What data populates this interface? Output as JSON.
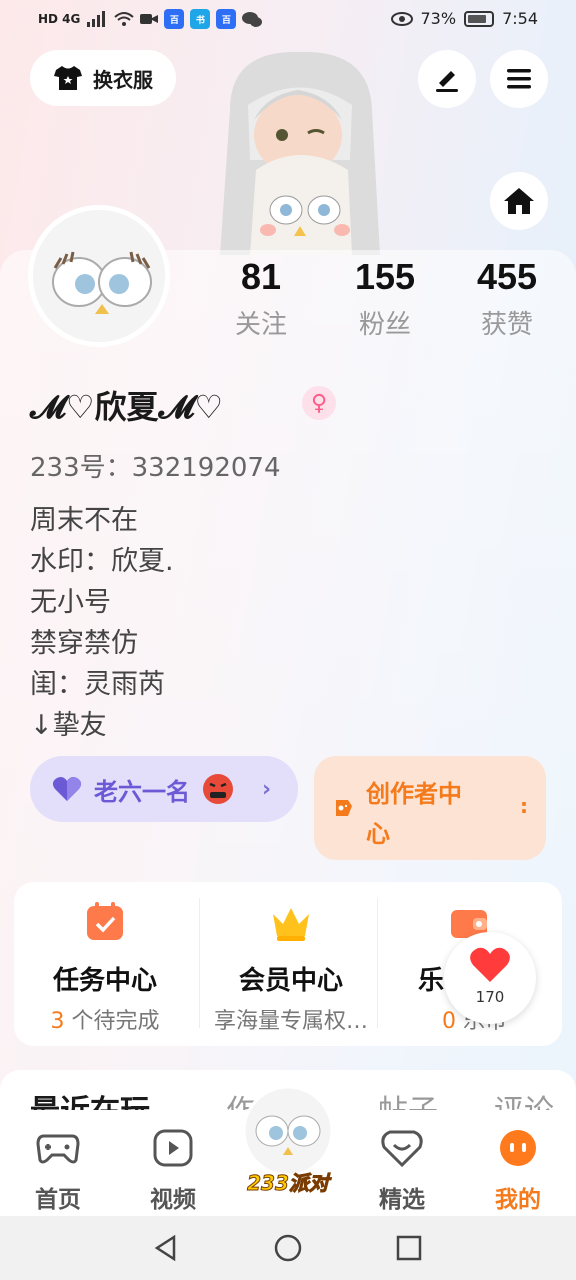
{
  "status_bar": {
    "network": "HD 4G",
    "battery_percent": "73%",
    "time": "7:54"
  },
  "header": {
    "dress_button": "换衣服"
  },
  "stats": [
    {
      "value": "81",
      "label": "关注"
    },
    {
      "value": "155",
      "label": "粉丝"
    },
    {
      "value": "455",
      "label": "获赞"
    }
  ],
  "profile": {
    "nickname": "𝓜♡欣夏𝓜♡",
    "uid": "233号：332192074",
    "bio": [
      "周末不在",
      "水印：欣夏.",
      "无小号",
      "禁穿禁仿",
      "闺：灵雨芮",
      "↓挚友"
    ]
  },
  "tags": {
    "rank_label": "老六一名",
    "creator_label_line1": "创作者中",
    "creator_label_line2": "心"
  },
  "services": [
    {
      "title": "任务中心",
      "count": "3",
      "suffix": " 个待完成"
    },
    {
      "title": "会员中心",
      "sub": "享海量专属权…"
    },
    {
      "title": "乐币",
      "count": "0",
      "suffix": " 乐币"
    }
  ],
  "float_like": {
    "count": "170"
  },
  "recent_tabs": [
    "最近在玩",
    "作品",
    "帖子",
    "评论"
  ],
  "bottom_nav": {
    "home": "首页",
    "video": "视频",
    "party": "233派对",
    "featured": "精选",
    "mine": "我的"
  },
  "colors": {
    "accent_orange": "#f57a1c",
    "rank_purple": "#6b59d6"
  }
}
